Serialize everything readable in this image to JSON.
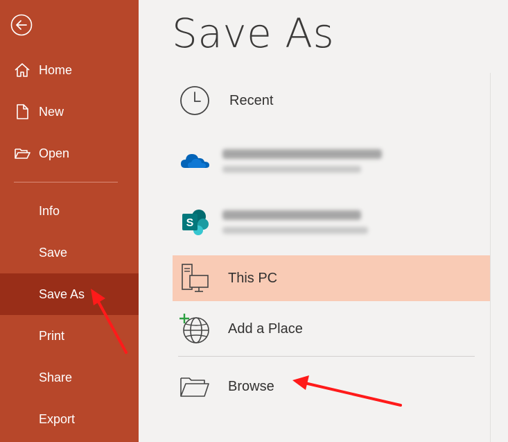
{
  "sidebar": {
    "back_icon": "back-arrow-icon",
    "items": [
      {
        "label": "Home",
        "icon": "home-icon"
      },
      {
        "label": "New",
        "icon": "new-document-icon"
      },
      {
        "label": "Open",
        "icon": "open-folder-icon"
      },
      {
        "label": "Info"
      },
      {
        "label": "Save"
      },
      {
        "label": "Save As",
        "active": true
      },
      {
        "label": "Print"
      },
      {
        "label": "Share"
      },
      {
        "label": "Export"
      }
    ]
  },
  "main": {
    "title": "Save As",
    "locations": [
      {
        "label": "Recent",
        "icon": "clock-icon"
      },
      {
        "label": "",
        "icon": "onedrive-cloud-icon",
        "blurred": true
      },
      {
        "label": "",
        "icon": "sharepoint-icon",
        "blurred": true
      },
      {
        "label": "This PC",
        "icon": "this-pc-icon",
        "selected": true
      },
      {
        "label": "Add a Place",
        "icon": "add-place-globe-icon"
      },
      {
        "label": "Browse",
        "icon": "browse-folder-icon"
      }
    ]
  },
  "colors": {
    "sidebar_bg": "#b7472a",
    "sidebar_active": "#992e18",
    "selected_row": "#f9cbb5",
    "page_bg": "#f3f2f1",
    "onedrive_blue": "#0364b8",
    "sharepoint_teal": "#036c70",
    "annotation_red": "#ff1a1a"
  }
}
